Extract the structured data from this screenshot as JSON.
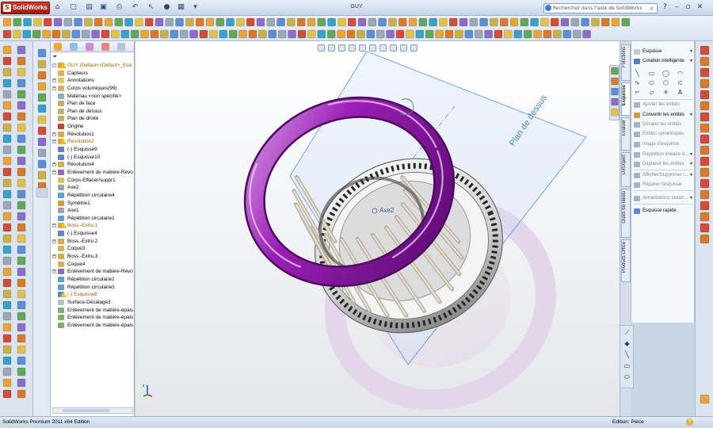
{
  "app": {
    "logo_text": "SolidWorks",
    "window_title": "GUY",
    "help_search_placeholder": "Rechercher dans l'aide de SolidWorks"
  },
  "feature_tree": {
    "items": [
      {
        "label": "GUY  (Défaut<<Défaut>_Etat",
        "icon": "part-icon",
        "warn": true,
        "expand": "-"
      },
      {
        "label": "Capteurs",
        "icon": "sensors-folder-icon",
        "expand": ""
      },
      {
        "label": "Annotations",
        "icon": "annotations-icon",
        "expand": "+"
      },
      {
        "label": "Corps volumiques(99)",
        "icon": "solid-bodies-icon",
        "expand": "+"
      },
      {
        "label": "Matériau <non spécifié>",
        "icon": "material-icon",
        "expand": ""
      },
      {
        "label": "Plan de face",
        "icon": "plane-icon",
        "expand": ""
      },
      {
        "label": "Plan de dessus",
        "icon": "plane-icon",
        "expand": ""
      },
      {
        "label": "Plan de droite",
        "icon": "plane-icon",
        "expand": ""
      },
      {
        "label": "Origine",
        "icon": "origin-icon",
        "expand": ""
      },
      {
        "label": "Révolution1",
        "icon": "revolve-icon",
        "expand": "+"
      },
      {
        "label": "Révolution2",
        "icon": "revolve-icon",
        "warn": true,
        "expand": "+"
      },
      {
        "label": "(-) Esquisse9",
        "icon": "sketch-icon",
        "expand": ""
      },
      {
        "label": "(-) Esquisse10",
        "icon": "sketch-icon",
        "expand": ""
      },
      {
        "label": "Révolution4",
        "icon": "revolve-icon",
        "expand": "+"
      },
      {
        "label": "Enlèvement de matière-Révo",
        "icon": "cut-revolve-icon",
        "expand": "+"
      },
      {
        "label": "Corps-Effacer/suppr1",
        "icon": "delete-body-icon",
        "expand": ""
      },
      {
        "label": "Axe2",
        "icon": "axis-icon",
        "expand": ""
      },
      {
        "label": "Répétition circulaire4",
        "icon": "circular-pattern-icon",
        "expand": ""
      },
      {
        "label": "Symétrie1",
        "icon": "mirror-icon",
        "expand": ""
      },
      {
        "label": "Axe1",
        "icon": "axis-icon",
        "expand": ""
      },
      {
        "label": "Répétition circulaire1",
        "icon": "circular-pattern-icon",
        "expand": ""
      },
      {
        "label": "Boss.-Extru.1",
        "icon": "boss-extrude-icon",
        "warn": true,
        "expand": "+"
      },
      {
        "label": "(-) Esquisse4",
        "icon": "sketch-icon",
        "expand": ""
      },
      {
        "label": "Boss.-Extru.2",
        "icon": "boss-extrude-icon",
        "expand": "+"
      },
      {
        "label": "Coque3",
        "icon": "shell-icon",
        "expand": ""
      },
      {
        "label": "Boss.-Extru.3",
        "icon": "boss-extrude-icon",
        "expand": "+"
      },
      {
        "label": "Coque4",
        "icon": "shell-icon",
        "expand": ""
      },
      {
        "label": "Enlèvement de matière-Révo",
        "icon": "cut-revolve-icon",
        "expand": "+"
      },
      {
        "label": "Répétition circulaire2",
        "icon": "circular-pattern-icon",
        "expand": ""
      },
      {
        "label": "Répétition circulaire3",
        "icon": "circular-pattern-icon",
        "expand": ""
      },
      {
        "label": "(-) Esquisse8",
        "icon": "sketch-icon",
        "warn": true,
        "expand": ""
      },
      {
        "label": "Surface-Décalage3",
        "icon": "offset-surface-icon",
        "expand": ""
      },
      {
        "label": "Enlèvement de matière-épais",
        "icon": "thicken-cut-icon",
        "expand": ""
      },
      {
        "label": "Enlèvement de matière-épais",
        "icon": "thicken-cut-icon",
        "expand": ""
      },
      {
        "label": "Enlèvement de matière-épais",
        "icon": "thicken-cut-icon",
        "expand": ""
      }
    ]
  },
  "viewport": {
    "plane_label": "Plan de dessus",
    "axis_label": "Axe2",
    "triad_z_label": "z"
  },
  "command_manager": {
    "tabs": [
      "Fonctions",
      "Esquisse",
      "Evaluer",
      "DimXpert",
      "Outils de rendu",
      "Produits Office"
    ],
    "active_tab": "Esquisse"
  },
  "sketch_panel": {
    "commands": [
      {
        "label": "Esquisse",
        "dim": false,
        "arrow": "▾"
      },
      {
        "label": "Cotation intelligente",
        "dim": false,
        "arrow": "▾"
      },
      {
        "label": "Ajuster les entités",
        "dim": true,
        "arrow": ""
      },
      {
        "label": "Convertir les entités",
        "dim": false,
        "arrow": "▾"
      },
      {
        "label": "Décaler les entités",
        "dim": true,
        "arrow": ""
      },
      {
        "label": "Entités symétriques",
        "dim": true,
        "arrow": ""
      },
      {
        "label": "Image d'esquisse",
        "dim": true,
        "arrow": ""
      },
      {
        "label": "Répétition linéaire d...",
        "dim": true,
        "arrow": "▾"
      },
      {
        "label": "Déplacer les entités",
        "dim": true,
        "arrow": "▾"
      },
      {
        "label": "Afficher/Supprimer l...",
        "dim": true,
        "arrow": "▾"
      },
      {
        "label": "Réparer l'esquisse",
        "dim": true,
        "arrow": ""
      },
      {
        "label": "Aimantations instan...",
        "dim": true,
        "arrow": "▾"
      },
      {
        "label": "Esquisse rapide",
        "dim": false,
        "arrow": ""
      }
    ]
  },
  "status_bar": {
    "left": "SolidWorks Premium 2011 x64 Edition",
    "right": "Edition: Pièce",
    "help": "?"
  },
  "colors": {
    "torus": "#9a1fb5",
    "plane_outline": "#5b8fdc",
    "accent": "#2c4a78"
  }
}
